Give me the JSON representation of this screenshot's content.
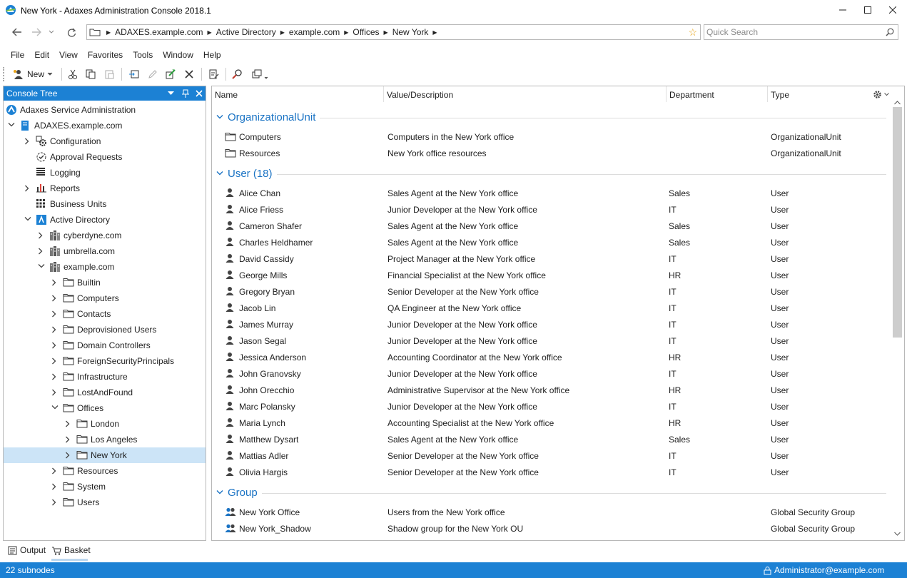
{
  "window": {
    "title": "New York - Adaxes Administration Console 2018.1"
  },
  "address": {
    "crumbs": [
      "ADAXES.example.com",
      "Active Directory",
      "example.com",
      "Offices",
      "New York"
    ]
  },
  "search": {
    "placeholder": "Quick Search"
  },
  "menu": [
    "File",
    "Edit",
    "View",
    "Favorites",
    "Tools",
    "Window",
    "Help"
  ],
  "toolbar": {
    "new_label": "New"
  },
  "tree": {
    "header": "Console Tree",
    "items": [
      {
        "label": "Adaxes Service Administration",
        "level": 0,
        "chevron": "none",
        "icon": "adaxes-logo-icon"
      },
      {
        "label": "ADAXES.example.com",
        "level": 0,
        "chevron": "open",
        "icon": "server-icon"
      },
      {
        "label": "Configuration",
        "level": 1,
        "chevron": "closed",
        "icon": "configuration-icon"
      },
      {
        "label": "Approval Requests",
        "level": 1,
        "chevron": "none",
        "icon": "approval-icon"
      },
      {
        "label": "Logging",
        "level": 1,
        "chevron": "none",
        "icon": "logging-icon"
      },
      {
        "label": "Reports",
        "level": 1,
        "chevron": "closed",
        "icon": "reports-icon"
      },
      {
        "label": "Business Units",
        "level": 1,
        "chevron": "none",
        "icon": "business-units-icon"
      },
      {
        "label": "Active Directory",
        "level": 1,
        "chevron": "open",
        "icon": "active-directory-icon"
      },
      {
        "label": "cyberdyne.com",
        "level": 2,
        "chevron": "closed",
        "icon": "domain-icon"
      },
      {
        "label": "umbrella.com",
        "level": 2,
        "chevron": "closed",
        "icon": "domain-icon"
      },
      {
        "label": "example.com",
        "level": 2,
        "chevron": "open",
        "icon": "domain-icon"
      },
      {
        "label": "Builtin",
        "level": 3,
        "chevron": "closed",
        "icon": "folder-icon"
      },
      {
        "label": "Computers",
        "level": 3,
        "chevron": "closed",
        "icon": "folder-icon"
      },
      {
        "label": "Contacts",
        "level": 3,
        "chevron": "closed",
        "icon": "folder-icon"
      },
      {
        "label": "Deprovisioned Users",
        "level": 3,
        "chevron": "closed",
        "icon": "folder-icon"
      },
      {
        "label": "Domain Controllers",
        "level": 3,
        "chevron": "closed",
        "icon": "folder-icon"
      },
      {
        "label": "ForeignSecurityPrincipals",
        "level": 3,
        "chevron": "closed",
        "icon": "folder-icon"
      },
      {
        "label": "Infrastructure",
        "level": 3,
        "chevron": "closed",
        "icon": "folder-icon"
      },
      {
        "label": "LostAndFound",
        "level": 3,
        "chevron": "closed",
        "icon": "folder-icon"
      },
      {
        "label": "Offices",
        "level": 3,
        "chevron": "open",
        "icon": "folder-icon"
      },
      {
        "label": "London",
        "level": 4,
        "chevron": "closed",
        "icon": "folder-icon"
      },
      {
        "label": "Los Angeles",
        "level": 4,
        "chevron": "closed",
        "icon": "folder-icon"
      },
      {
        "label": "New York",
        "level": 4,
        "chevron": "closed",
        "icon": "folder-icon",
        "selected": true
      },
      {
        "label": "Resources",
        "level": 3,
        "chevron": "closed",
        "icon": "folder-icon"
      },
      {
        "label": "System",
        "level": 3,
        "chevron": "closed",
        "icon": "folder-icon"
      },
      {
        "label": "Users",
        "level": 3,
        "chevron": "closed",
        "icon": "folder-icon"
      }
    ]
  },
  "list": {
    "columns": [
      "Name",
      "Value/Description",
      "Department",
      "Type"
    ],
    "groups": [
      {
        "title": "OrganizationalUnit",
        "icon": "folder-icon",
        "rows": [
          {
            "name": "Computers",
            "desc": "Computers in the New York office",
            "dept": "",
            "type": "OrganizationalUnit"
          },
          {
            "name": "Resources",
            "desc": "New York office resources",
            "dept": "",
            "type": "OrganizationalUnit"
          }
        ]
      },
      {
        "title": "User (18)",
        "icon": "user-icon",
        "rows": [
          {
            "name": "Alice Chan",
            "desc": "Sales Agent at the New York office",
            "dept": "Sales",
            "type": "User"
          },
          {
            "name": "Alice Friess",
            "desc": "Junior Developer at the New York office",
            "dept": "IT",
            "type": "User"
          },
          {
            "name": "Cameron Shafer",
            "desc": "Sales Agent at the New York office",
            "dept": "Sales",
            "type": "User"
          },
          {
            "name": "Charles Heldhamer",
            "desc": "Sales Agent at the New York office",
            "dept": "Sales",
            "type": "User"
          },
          {
            "name": "David Cassidy",
            "desc": "Project Manager at the New York office",
            "dept": "IT",
            "type": "User"
          },
          {
            "name": "George Mills",
            "desc": "Financial Specialist at the New York office",
            "dept": "HR",
            "type": "User"
          },
          {
            "name": "Gregory Bryan",
            "desc": "Senior Developer at the New York office",
            "dept": "IT",
            "type": "User"
          },
          {
            "name": "Jacob Lin",
            "desc": "QA Engineer at the New York office",
            "dept": "IT",
            "type": "User"
          },
          {
            "name": "James Murray",
            "desc": "Junior Developer at the New York office",
            "dept": "IT",
            "type": "User"
          },
          {
            "name": "Jason Segal",
            "desc": "Junior Developer at the New York office",
            "dept": "IT",
            "type": "User"
          },
          {
            "name": "Jessica Anderson",
            "desc": "Accounting Coordinator at the New York office",
            "dept": "HR",
            "type": "User"
          },
          {
            "name": "John Granovsky",
            "desc": "Junior Developer at the New York office",
            "dept": "IT",
            "type": "User"
          },
          {
            "name": "John Orecchio",
            "desc": "Administrative Supervisor at the New York office",
            "dept": "HR",
            "type": "User"
          },
          {
            "name": "Marc Polansky",
            "desc": "Junior Developer at the New York office",
            "dept": "IT",
            "type": "User"
          },
          {
            "name": "Maria Lynch",
            "desc": "Accounting Specialist at the New York office",
            "dept": "HR",
            "type": "User"
          },
          {
            "name": "Matthew Dysart",
            "desc": "Sales Agent at the New York office",
            "dept": "Sales",
            "type": "User"
          },
          {
            "name": "Mattias Adler",
            "desc": "Senior Developer at the New York office",
            "dept": "IT",
            "type": "User"
          },
          {
            "name": "Olivia Hargis",
            "desc": "Senior Developer at the New York office",
            "dept": "IT",
            "type": "User"
          }
        ]
      },
      {
        "title": "Group",
        "icon": "group-icon",
        "rows": [
          {
            "name": "New York Office",
            "desc": "Users from the New York office",
            "dept": "",
            "type": "Global Security Group"
          },
          {
            "name": "New York_Shadow",
            "desc": "Shadow group for the New York OU",
            "dept": "",
            "type": "Global Security Group"
          }
        ]
      }
    ]
  },
  "bottom_tabs": {
    "output": "Output",
    "basket": "Basket"
  },
  "status": {
    "left": "22 subnodes",
    "user": "Administrator@example.com"
  },
  "colors": {
    "accent": "#1c81d4",
    "group_title": "#1a73c4",
    "selection": "#cce4f7"
  }
}
